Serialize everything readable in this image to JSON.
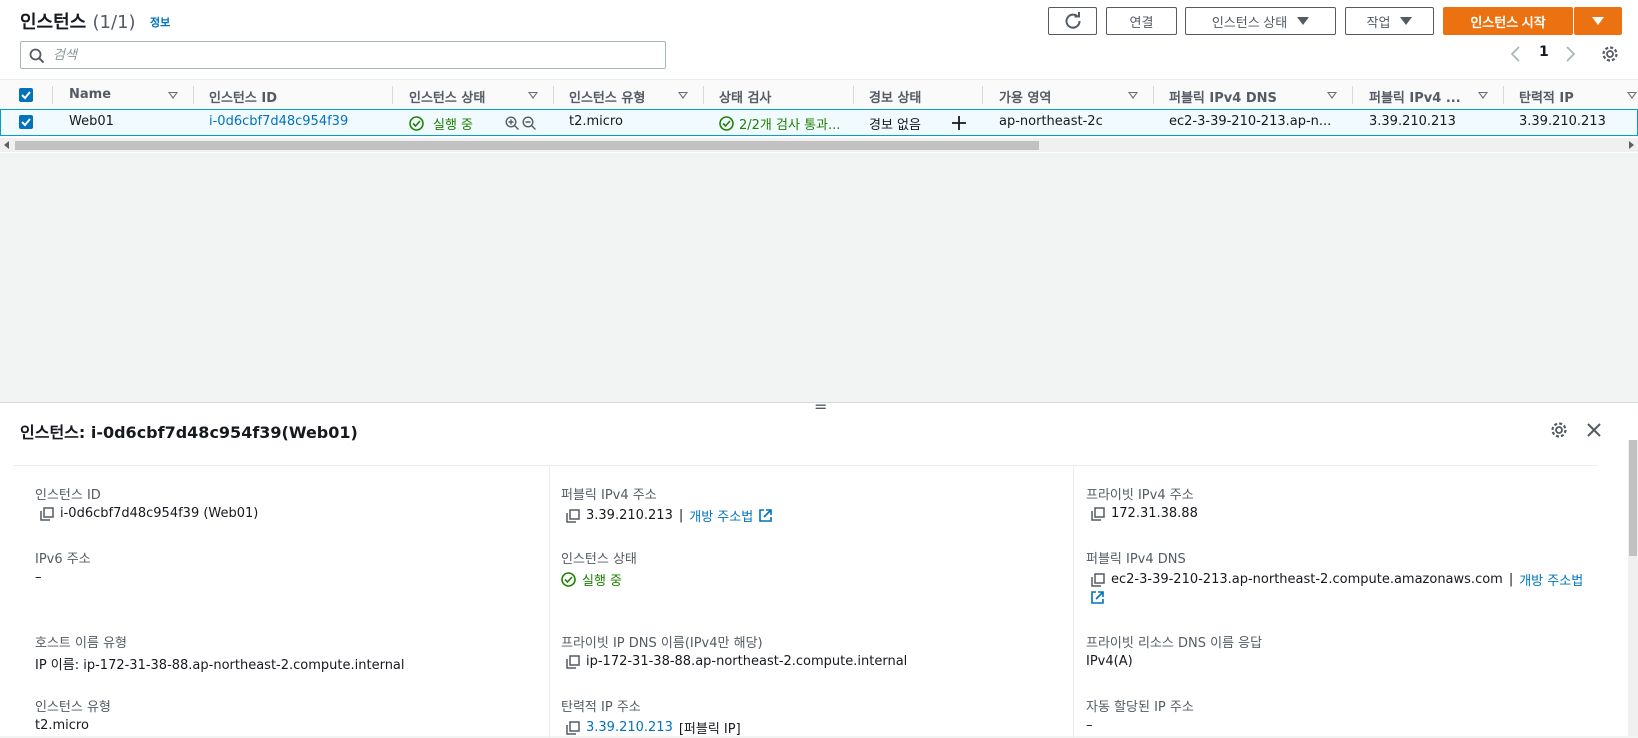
{
  "header": {
    "title": "인스턴스",
    "count": "(1/1)",
    "info": "정보",
    "connect_label": "연결",
    "instance_state_label": "인스턴스 상태",
    "actions_label": "작업",
    "launch_label": "인스턴스 시작"
  },
  "search": {
    "placeholder": "검색"
  },
  "pagination": {
    "page": "1"
  },
  "table": {
    "columns": [
      "Name",
      "인스턴스 ID",
      "인스턴스 상태",
      "인스턴스 유형",
      "상태 검사",
      "경보 상태",
      "가용 영역",
      "퍼블릭 IPv4 DNS",
      "퍼블릭 IPv4 ...",
      "탄력적 IP"
    ],
    "row": {
      "name": "Web01",
      "instance_id": "i-0d6cbf7d48c954f39",
      "state": "실행 중",
      "type": "t2.micro",
      "status_check": "2/2개 검사 통과...",
      "alarm": "경보 없음",
      "az": "ap-northeast-2c",
      "public_dns": "ec2-3-39-210-213.ap-n...",
      "public_ip": "3.39.210.213",
      "elastic_ip": "3.39.210.213"
    }
  },
  "detail": {
    "title": "인스턴스: i-0d6cbf7d48c954f39(Web01)",
    "instance_id_label": "인스턴스 ID",
    "instance_id_value": "i-0d6cbf7d48c954f39 (Web01)",
    "ipv6_label": "IPv6 주소",
    "ipv6_value": "–",
    "hostname_type_label": "호스트 이름 유형",
    "hostname_type_value": "IP 이름: ip-172-31-38-88.ap-northeast-2.compute.internal",
    "instance_type_label": "인스턴스 유형",
    "instance_type_value": "t2.micro",
    "public_ipv4_label": "퍼블릭 IPv4 주소",
    "public_ipv4_value": "3.39.210.213",
    "open_address_label": "개방 주소법",
    "state_label": "인스턴스 상태",
    "state_value": "실행 중",
    "private_dns_label": "프라이빗 IP DNS 이름(IPv4만 해당)",
    "private_dns_value": "ip-172-31-38-88.ap-northeast-2.compute.internal",
    "elastic_ip_label": "탄력적 IP 주소",
    "elastic_ip_value": "3.39.210.213",
    "elastic_ip_suffix": "[퍼블릭 IP]",
    "private_ipv4_label": "프라이빗 IPv4 주소",
    "private_ipv4_value": "172.31.38.88",
    "public_dns_label": "퍼블릭 IPv4 DNS",
    "public_dns_value": "ec2-3-39-210-213.ap-northeast-2.compute.amazonaws.com",
    "resource_dns_label": "프라이빗 리소스 DNS 이름 응답",
    "resource_dns_value": "IPv4(A)",
    "auto_ip_label": "자동 할당된 IP 주소",
    "auto_ip_value": "–"
  },
  "colors": {
    "accent": "#0073bb",
    "primary_button": "#ec7211",
    "success": "#1d8102"
  }
}
